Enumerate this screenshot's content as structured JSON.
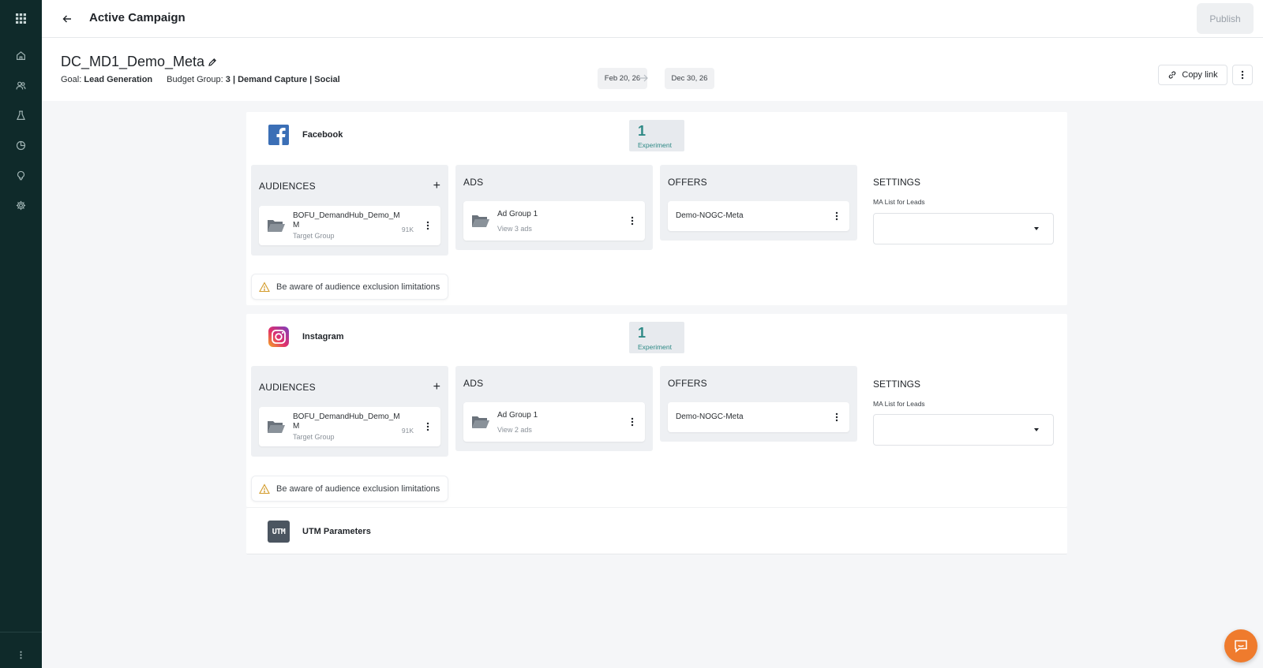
{
  "topbar": {
    "title": "Active Campaign",
    "publish_label": "Publish"
  },
  "header": {
    "campaign_name": "DC_MD1_Demo_Meta",
    "goal_label": "Goal:",
    "goal_value": "Lead Generation",
    "budget_label": "Budget Group:",
    "budget_value": "3 | Demand Capture | Social",
    "start_date": "Feb 20, 26",
    "end_date": "Dec 30, 26",
    "copy_link_label": "Copy link"
  },
  "channels": [
    {
      "name": "Facebook",
      "experiment_count": "1",
      "experiment_label": "Experiment",
      "audiences_title": "AUDIENCES",
      "audience": {
        "name": "BOFU_DemandHub_Demo_MM",
        "type": "Target Group",
        "size": "91K"
      },
      "ads_title": "ADS",
      "ad_group": {
        "name": "Ad Group 1",
        "sub": "View 3 ads"
      },
      "offers_title": "OFFERS",
      "offer": "Demo-NOGC-Meta",
      "settings_title": "SETTINGS",
      "settings_label": "MA List for Leads",
      "warning": "Be aware of audience exclusion limitations"
    },
    {
      "name": "Instagram",
      "experiment_count": "1",
      "experiment_label": "Experiment",
      "audiences_title": "AUDIENCES",
      "audience": {
        "name": "BOFU_DemandHub_Demo_MM",
        "type": "Target Group",
        "size": "91K"
      },
      "ads_title": "ADS",
      "ad_group": {
        "name": "Ad Group 1",
        "sub": "View 2 ads"
      },
      "offers_title": "OFFERS",
      "offer": "Demo-NOGC-Meta",
      "settings_title": "SETTINGS",
      "settings_label": "MA List for Leads",
      "warning": "Be aware of audience exclusion limitations"
    }
  ],
  "utm": {
    "icon_text": "UTM",
    "label": "UTM Parameters"
  },
  "colors": {
    "sidebar": "#0f2a2a",
    "accent": "#2f8a86",
    "chat": "#ef7b2d",
    "facebook": "#3b6fb6",
    "warning": "#d39b2a"
  },
  "icons": [
    "apps-grid-icon",
    "home-icon",
    "users-icon",
    "flask-icon",
    "pie-chart-icon",
    "lightbulb-icon",
    "gear-icon",
    "more-vertical-icon",
    "back-arrow-icon",
    "pencil-icon",
    "arrow-right-icon",
    "link-icon",
    "kebab-icon",
    "facebook-icon",
    "instagram-icon",
    "plus-icon",
    "folder-icon",
    "chevron-down-icon",
    "warning-icon",
    "chat-icon"
  ]
}
